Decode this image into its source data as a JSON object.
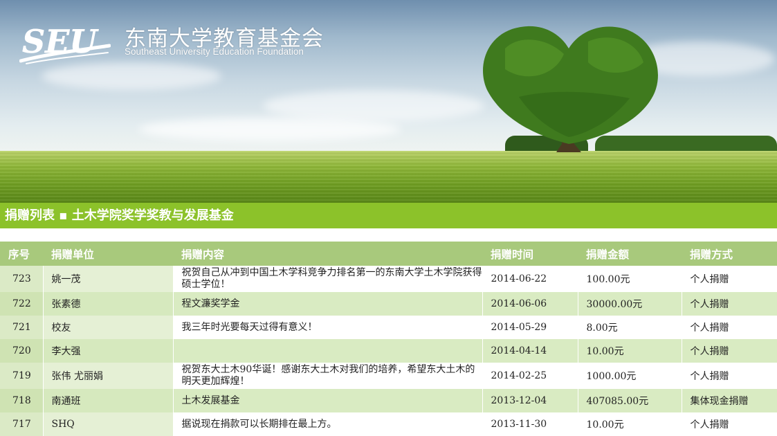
{
  "header": {
    "org_name_cn": "东南大学教育基金会",
    "org_name_en": "Southeast University Education Foundation",
    "logo_text": "SEU"
  },
  "section": {
    "title": "捐赠列表 ▪ 土木学院奖学奖教与发展基金"
  },
  "table": {
    "columns": [
      "序号",
      "捐赠单位",
      "捐赠内容",
      "捐赠时间",
      "捐赠金额",
      "捐赠方式"
    ],
    "rows": [
      {
        "no": "723",
        "donor": "姚一茂",
        "content": "祝贺自己从冲到中国土木学科竞争力排名第一的东南大学土木学院获得硕士学位！",
        "date": "2014-06-22",
        "amount": "100.00元",
        "method": "个人捐赠"
      },
      {
        "no": "722",
        "donor": "张素德",
        "content": "程文濂奖学金",
        "date": "2014-06-06",
        "amount": "30000.00元",
        "method": "个人捐赠"
      },
      {
        "no": "721",
        "donor": "校友",
        "content": "我三年时光要每天过得有意义！",
        "date": "2014-05-29",
        "amount": "8.00元",
        "method": "个人捐赠"
      },
      {
        "no": "720",
        "donor": "李大强",
        "content": "",
        "date": "2014-04-14",
        "amount": "10.00元",
        "method": "个人捐赠"
      },
      {
        "no": "719",
        "donor": "张伟 尤丽娟",
        "content": "祝贺东大土木90华诞！感谢东大土木对我们的培养，希望东大土木的明天更加辉煌！",
        "date": "2014-02-25",
        "amount": "1000.00元",
        "method": "个人捐赠"
      },
      {
        "no": "718",
        "donor": "南通班",
        "content": "土木发展基金",
        "date": "2013-12-04",
        "amount": "407085.00元",
        "method": "集体现金捐赠"
      },
      {
        "no": "717",
        "donor": "SHQ",
        "content": "据说现在捐款可以长期排在最上方。",
        "date": "2013-11-30",
        "amount": "10.00元",
        "method": "个人捐赠"
      }
    ]
  },
  "colors": {
    "section_bar": "#8cc22a",
    "header_row": "#a8c97c",
    "row_alt": "#d9ebc2"
  }
}
